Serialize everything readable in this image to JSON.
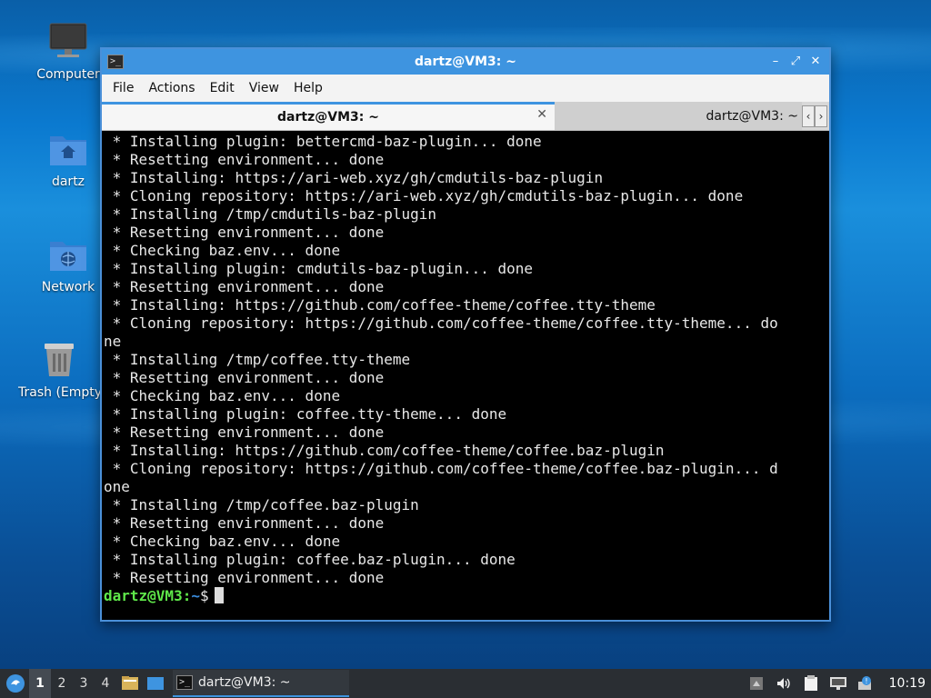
{
  "desktop": {
    "icons": [
      {
        "label": "Computer",
        "icon": "computer-icon"
      },
      {
        "label": "dartz",
        "icon": "home-folder-icon"
      },
      {
        "label": "Network",
        "icon": "network-folder-icon"
      },
      {
        "label": "Trash (Empty)",
        "icon": "trash-icon"
      }
    ]
  },
  "window": {
    "title": "dartz@VM3: ~",
    "controls": {
      "minimize": "–",
      "maximize": "⤢",
      "close": "✕"
    },
    "menu": [
      "File",
      "Actions",
      "Edit",
      "View",
      "Help"
    ],
    "tabs": [
      {
        "label": "dartz@VM3: ~",
        "active": true
      },
      {
        "label": "dartz@VM3: ~",
        "active": false
      }
    ],
    "tab_close": "✕",
    "tab_scroll_left": "‹",
    "tab_scroll_right": "›"
  },
  "terminal": {
    "lines": [
      " * Installing plugin: bettercmd-baz-plugin... done",
      " * Resetting environment... done",
      " * Installing: https://ari-web.xyz/gh/cmdutils-baz-plugin",
      " * Cloning repository: https://ari-web.xyz/gh/cmdutils-baz-plugin... done",
      " * Installing /tmp/cmdutils-baz-plugin",
      " * Resetting environment... done",
      " * Checking baz.env... done",
      " * Installing plugin: cmdutils-baz-plugin... done",
      " * Resetting environment... done",
      " * Installing: https://github.com/coffee-theme/coffee.tty-theme",
      " * Cloning repository: https://github.com/coffee-theme/coffee.tty-theme... do",
      "ne",
      " * Installing /tmp/coffee.tty-theme",
      " * Resetting environment... done",
      " * Checking baz.env... done",
      " * Installing plugin: coffee.tty-theme... done",
      " * Resetting environment... done",
      " * Installing: https://github.com/coffee-theme/coffee.baz-plugin",
      " * Cloning repository: https://github.com/coffee-theme/coffee.baz-plugin... d",
      "one",
      " * Installing /tmp/coffee.baz-plugin",
      " * Resetting environment... done",
      " * Checking baz.env... done",
      " * Installing plugin: coffee.baz-plugin... done",
      " * Resetting environment... done"
    ],
    "prompt_user": "dartz@VM3",
    "prompt_sep": ":",
    "prompt_path": "~",
    "prompt_symbol": "$"
  },
  "taskbar": {
    "workspaces": [
      "1",
      "2",
      "3",
      "4"
    ],
    "active_workspace": "1",
    "task_label": "dartz@VM3: ~",
    "clock": "10:19"
  },
  "colors": {
    "accent": "#3e94e0",
    "prompt_user": "#5fe84a",
    "prompt_path": "#3b8ee0",
    "terminal_bg": "#000000",
    "terminal_fg": "#e8e8e8"
  }
}
